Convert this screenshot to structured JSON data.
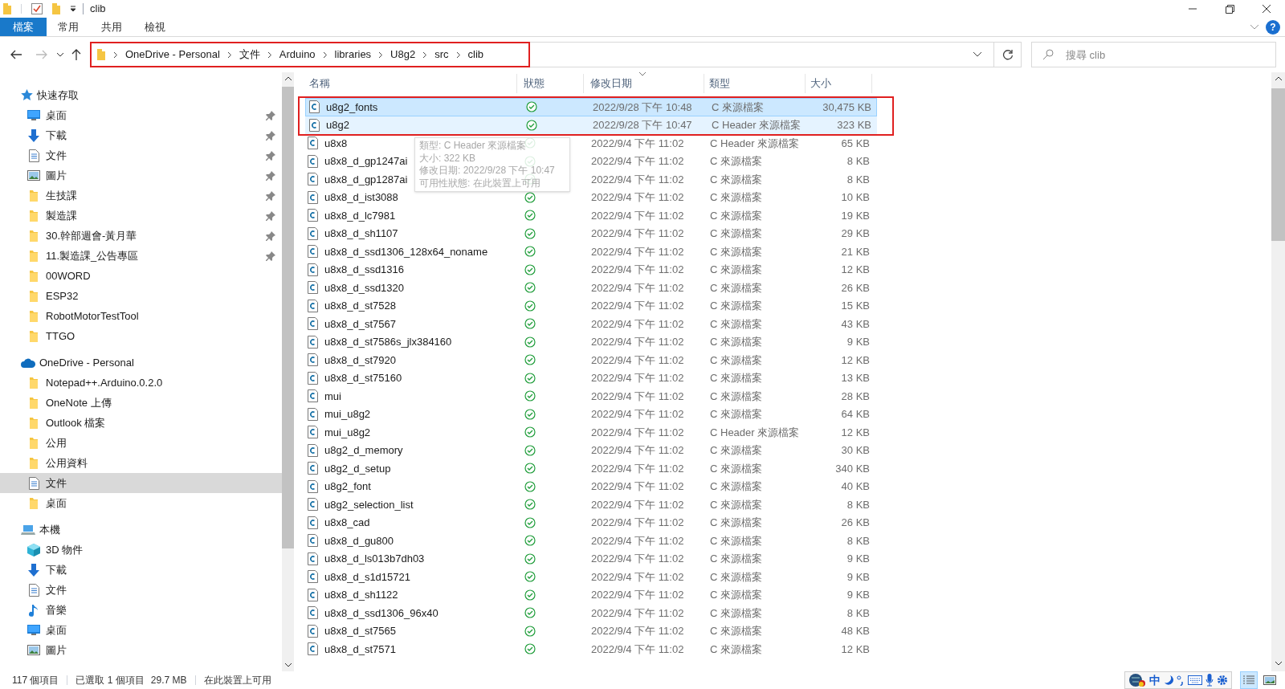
{
  "window": {
    "title": "clib"
  },
  "ribbon": {
    "tabs": [
      {
        "label": "檔案",
        "kind": "file"
      },
      {
        "label": "常用",
        "kind": "tab"
      },
      {
        "label": "共用",
        "kind": "tab"
      },
      {
        "label": "檢視",
        "kind": "tab"
      }
    ],
    "help": "?"
  },
  "address_bar": {
    "segments": [
      "OneDrive - Personal",
      "文件",
      "Arduino",
      "libraries",
      "U8g2",
      "src",
      "clib"
    ],
    "annotated": true
  },
  "search": {
    "placeholder": "搜尋 clib"
  },
  "sidebar": {
    "groups": [
      {
        "label": "快速存取",
        "kind": "star",
        "children": [
          {
            "label": "桌面",
            "kind": "desktop",
            "pinned": true,
            "selected": false
          },
          {
            "label": "下載",
            "kind": "download",
            "pinned": true,
            "selected": false
          },
          {
            "label": "文件",
            "kind": "document",
            "pinned": true,
            "selected": false
          },
          {
            "label": "圖片",
            "kind": "pictures",
            "pinned": true,
            "selected": false
          },
          {
            "label": "生技課",
            "kind": "folder",
            "pinned": true,
            "selected": false
          },
          {
            "label": "製造課",
            "kind": "folder",
            "pinned": true,
            "selected": false
          },
          {
            "label": "30.幹部週會-黃月華",
            "kind": "folder",
            "pinned": true,
            "selected": false
          },
          {
            "label": "11.製造課_公告專區",
            "kind": "folder",
            "pinned": true,
            "selected": false
          },
          {
            "label": "00WORD",
            "kind": "folder",
            "pinned": false,
            "selected": false
          },
          {
            "label": "ESP32",
            "kind": "folder",
            "pinned": false,
            "selected": false
          },
          {
            "label": "RobotMotorTestTool",
            "kind": "folder",
            "pinned": false,
            "selected": false
          },
          {
            "label": "TTGO",
            "kind": "folder",
            "pinned": false,
            "selected": false
          }
        ]
      },
      {
        "label": "OneDrive - Personal",
        "kind": "cloud",
        "children": [
          {
            "label": "Notepad++.Arduino.0.2.0",
            "kind": "folder",
            "pinned": false,
            "selected": false
          },
          {
            "label": "OneNote 上傳",
            "kind": "folder",
            "pinned": false,
            "selected": false
          },
          {
            "label": "Outlook 檔案",
            "kind": "folder",
            "pinned": false,
            "selected": false
          },
          {
            "label": "公用",
            "kind": "folder",
            "pinned": false,
            "selected": false
          },
          {
            "label": "公用資料",
            "kind": "folder",
            "pinned": false,
            "selected": false
          },
          {
            "label": "文件",
            "kind": "document",
            "pinned": false,
            "selected": true
          },
          {
            "label": "桌面",
            "kind": "folder",
            "pinned": false,
            "selected": false
          }
        ]
      },
      {
        "label": "本機",
        "kind": "pc",
        "children": [
          {
            "label": "3D 物件",
            "kind": "cube",
            "pinned": false,
            "selected": false
          },
          {
            "label": "下載",
            "kind": "download",
            "pinned": false,
            "selected": false
          },
          {
            "label": "文件",
            "kind": "document",
            "pinned": false,
            "selected": false
          },
          {
            "label": "音樂",
            "kind": "music",
            "pinned": false,
            "selected": false
          },
          {
            "label": "桌面",
            "kind": "desktop",
            "pinned": false,
            "selected": false
          },
          {
            "label": "圖片",
            "kind": "pictures",
            "pinned": false,
            "selected": false
          }
        ]
      }
    ]
  },
  "columns": [
    {
      "label": "名稱",
      "sorted": false
    },
    {
      "label": "狀態",
      "sorted": false
    },
    {
      "label": "修改日期",
      "sorted": true
    },
    {
      "label": "類型",
      "sorted": false
    },
    {
      "label": "大小",
      "sorted": false
    }
  ],
  "files": [
    {
      "name": "u8g2_fonts",
      "modified": "2022/9/28 下午 10:48",
      "type": "C 來源檔案",
      "size": "30,475 KB",
      "selected": true,
      "hovered": false,
      "annotated": true
    },
    {
      "name": "u8g2",
      "modified": "2022/9/28 下午 10:47",
      "type": "C Header 來源檔案",
      "size": "323 KB",
      "selected": false,
      "hovered": true,
      "annotated": true
    },
    {
      "name": "u8x8",
      "modified": "2022/9/4 下午 11:02",
      "type": "C Header 來源檔案",
      "size": "65 KB",
      "selected": false,
      "hovered": false,
      "annotated": false
    },
    {
      "name": "u8x8_d_gp1247ai",
      "modified": "2022/9/4 下午 11:02",
      "type": "C 來源檔案",
      "size": "8 KB",
      "selected": false,
      "hovered": false,
      "annotated": false
    },
    {
      "name": "u8x8_d_gp1287ai",
      "modified": "2022/9/4 下午 11:02",
      "type": "C 來源檔案",
      "size": "8 KB",
      "selected": false,
      "hovered": false,
      "annotated": false
    },
    {
      "name": "u8x8_d_ist3088",
      "modified": "2022/9/4 下午 11:02",
      "type": "C 來源檔案",
      "size": "10 KB",
      "selected": false,
      "hovered": false,
      "annotated": false
    },
    {
      "name": "u8x8_d_lc7981",
      "modified": "2022/9/4 下午 11:02",
      "type": "C 來源檔案",
      "size": "19 KB",
      "selected": false,
      "hovered": false,
      "annotated": false
    },
    {
      "name": "u8x8_d_sh1107",
      "modified": "2022/9/4 下午 11:02",
      "type": "C 來源檔案",
      "size": "29 KB",
      "selected": false,
      "hovered": false,
      "annotated": false
    },
    {
      "name": "u8x8_d_ssd1306_128x64_noname",
      "modified": "2022/9/4 下午 11:02",
      "type": "C 來源檔案",
      "size": "21 KB",
      "selected": false,
      "hovered": false,
      "annotated": false
    },
    {
      "name": "u8x8_d_ssd1316",
      "modified": "2022/9/4 下午 11:02",
      "type": "C 來源檔案",
      "size": "12 KB",
      "selected": false,
      "hovered": false,
      "annotated": false
    },
    {
      "name": "u8x8_d_ssd1320",
      "modified": "2022/9/4 下午 11:02",
      "type": "C 來源檔案",
      "size": "26 KB",
      "selected": false,
      "hovered": false,
      "annotated": false
    },
    {
      "name": "u8x8_d_st7528",
      "modified": "2022/9/4 下午 11:02",
      "type": "C 來源檔案",
      "size": "15 KB",
      "selected": false,
      "hovered": false,
      "annotated": false
    },
    {
      "name": "u8x8_d_st7567",
      "modified": "2022/9/4 下午 11:02",
      "type": "C 來源檔案",
      "size": "43 KB",
      "selected": false,
      "hovered": false,
      "annotated": false
    },
    {
      "name": "u8x8_d_st7586s_jlx384160",
      "modified": "2022/9/4 下午 11:02",
      "type": "C 來源檔案",
      "size": "9 KB",
      "selected": false,
      "hovered": false,
      "annotated": false
    },
    {
      "name": "u8x8_d_st7920",
      "modified": "2022/9/4 下午 11:02",
      "type": "C 來源檔案",
      "size": "12 KB",
      "selected": false,
      "hovered": false,
      "annotated": false
    },
    {
      "name": "u8x8_d_st75160",
      "modified": "2022/9/4 下午 11:02",
      "type": "C 來源檔案",
      "size": "13 KB",
      "selected": false,
      "hovered": false,
      "annotated": false
    },
    {
      "name": "mui",
      "modified": "2022/9/4 下午 11:02",
      "type": "C 來源檔案",
      "size": "28 KB",
      "selected": false,
      "hovered": false,
      "annotated": false
    },
    {
      "name": "mui_u8g2",
      "modified": "2022/9/4 下午 11:02",
      "type": "C 來源檔案",
      "size": "64 KB",
      "selected": false,
      "hovered": false,
      "annotated": false
    },
    {
      "name": "mui_u8g2",
      "modified": "2022/9/4 下午 11:02",
      "type": "C Header 來源檔案",
      "size": "12 KB",
      "selected": false,
      "hovered": false,
      "annotated": false
    },
    {
      "name": "u8g2_d_memory",
      "modified": "2022/9/4 下午 11:02",
      "type": "C 來源檔案",
      "size": "30 KB",
      "selected": false,
      "hovered": false,
      "annotated": false
    },
    {
      "name": "u8g2_d_setup",
      "modified": "2022/9/4 下午 11:02",
      "type": "C 來源檔案",
      "size": "340 KB",
      "selected": false,
      "hovered": false,
      "annotated": false
    },
    {
      "name": "u8g2_font",
      "modified": "2022/9/4 下午 11:02",
      "type": "C 來源檔案",
      "size": "40 KB",
      "selected": false,
      "hovered": false,
      "annotated": false
    },
    {
      "name": "u8g2_selection_list",
      "modified": "2022/9/4 下午 11:02",
      "type": "C 來源檔案",
      "size": "8 KB",
      "selected": false,
      "hovered": false,
      "annotated": false
    },
    {
      "name": "u8x8_cad",
      "modified": "2022/9/4 下午 11:02",
      "type": "C 來源檔案",
      "size": "26 KB",
      "selected": false,
      "hovered": false,
      "annotated": false
    },
    {
      "name": "u8x8_d_gu800",
      "modified": "2022/9/4 下午 11:02",
      "type": "C 來源檔案",
      "size": "8 KB",
      "selected": false,
      "hovered": false,
      "annotated": false
    },
    {
      "name": "u8x8_d_ls013b7dh03",
      "modified": "2022/9/4 下午 11:02",
      "type": "C 來源檔案",
      "size": "9 KB",
      "selected": false,
      "hovered": false,
      "annotated": false
    },
    {
      "name": "u8x8_d_s1d15721",
      "modified": "2022/9/4 下午 11:02",
      "type": "C 來源檔案",
      "size": "9 KB",
      "selected": false,
      "hovered": false,
      "annotated": false
    },
    {
      "name": "u8x8_d_sh1122",
      "modified": "2022/9/4 下午 11:02",
      "type": "C 來源檔案",
      "size": "9 KB",
      "selected": false,
      "hovered": false,
      "annotated": false
    },
    {
      "name": "u8x8_d_ssd1306_96x40",
      "modified": "2022/9/4 下午 11:02",
      "type": "C 來源檔案",
      "size": "8 KB",
      "selected": false,
      "hovered": false,
      "annotated": false
    },
    {
      "name": "u8x8_d_st7565",
      "modified": "2022/9/4 下午 11:02",
      "type": "C 來源檔案",
      "size": "48 KB",
      "selected": false,
      "hovered": false,
      "annotated": false
    },
    {
      "name": "u8x8_d_st7571",
      "modified": "2022/9/4 下午 11:02",
      "type": "C 來源檔案",
      "size": "12 KB",
      "selected": false,
      "hovered": false,
      "annotated": false
    }
  ],
  "tooltip": {
    "lines": [
      "類型: C Header 來源檔案",
      "大小: 322 KB",
      "修改日期: 2022/9/28 下午 10:47",
      "可用性狀態: 在此裝置上可用"
    ]
  },
  "status_bar": {
    "item_count": "117 個項目",
    "selection": "已選取 1 個項目",
    "selection_size": "29.7 MB",
    "availability": "在此裝置上可用"
  },
  "ime_bar": {
    "mode": "中"
  },
  "view_buttons": [
    {
      "kind": "details",
      "selected": true
    },
    {
      "kind": "large_icons",
      "selected": false
    }
  ]
}
